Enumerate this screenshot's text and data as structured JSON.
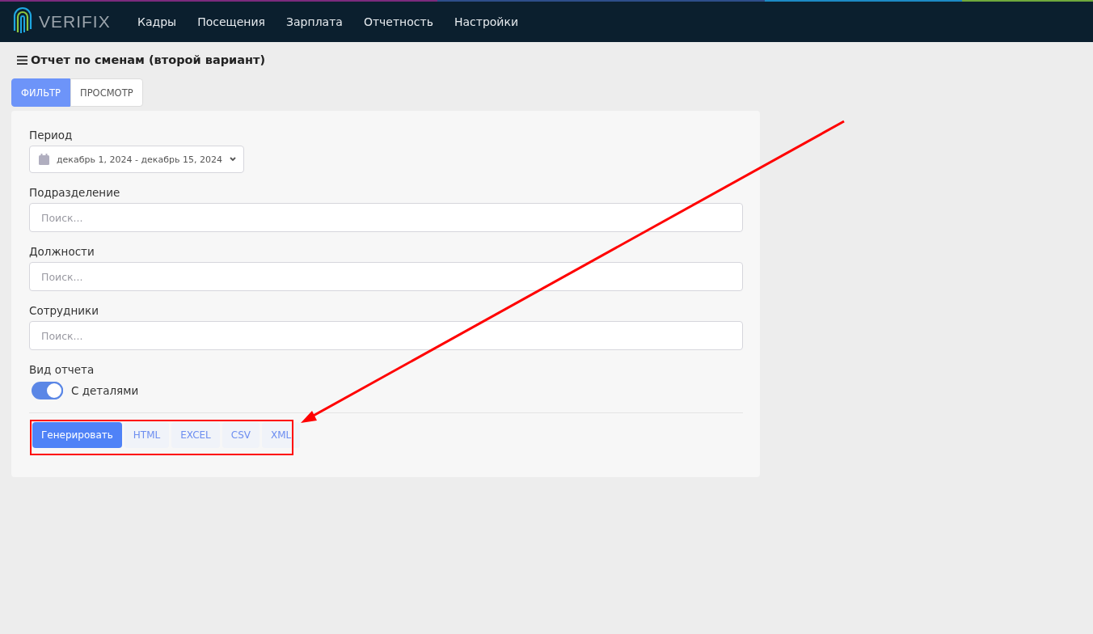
{
  "logo": {
    "text": "VERIFIX"
  },
  "nav": [
    {
      "label": "Кадры"
    },
    {
      "label": "Посещения"
    },
    {
      "label": "Зарплата"
    },
    {
      "label": "Отчетность"
    },
    {
      "label": "Настройки"
    }
  ],
  "page_title": "Отчет по сменам (второй вариант)",
  "tabs": [
    {
      "label": "ФИЛЬТР",
      "selected": true
    },
    {
      "label": "ПРОСМОТР",
      "selected": false
    }
  ],
  "filters": [
    {
      "kind": "daterange",
      "label": "Период",
      "value": "декабрь 1, 2024 - декабрь 15, 2024"
    },
    {
      "kind": "search",
      "label": "Подразделение",
      "placeholder": "Поиск..."
    },
    {
      "kind": "search",
      "label": "Должности",
      "placeholder": "Поиск..."
    },
    {
      "kind": "search",
      "label": "Сотрудники",
      "placeholder": "Поиск..."
    },
    {
      "kind": "toggle",
      "label": "Вид отчета",
      "option": "С деталями",
      "on": true
    }
  ],
  "actions": [
    {
      "label": "Генерировать",
      "kind": "primary"
    },
    {
      "label": "HTML",
      "kind": "export"
    },
    {
      "label": "EXCEL",
      "kind": "export"
    },
    {
      "label": "CSV",
      "kind": "export"
    },
    {
      "label": "XML",
      "kind": "export"
    }
  ]
}
